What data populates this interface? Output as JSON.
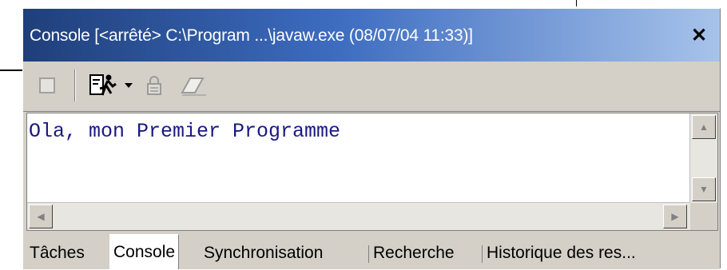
{
  "window": {
    "title": "Console [<arrêté> C:\\Program ...\\javaw.exe (08/07/04 11:33)]",
    "close_symbol": "✕"
  },
  "toolbar": {
    "icons": [
      "terminate-icon",
      "run-debug-icon",
      "dropdown-arrow-icon",
      "pin-icon",
      "clear-console-icon"
    ]
  },
  "console": {
    "output": "Ola, mon Premier Programme"
  },
  "tabs": [
    {
      "label": "Tâches",
      "active": false
    },
    {
      "label": "Console",
      "active": true
    },
    {
      "label": "Synchronisation",
      "active": false
    },
    {
      "label": "Recherche",
      "active": false
    },
    {
      "label": "Historique des res...",
      "active": false
    }
  ],
  "colors": {
    "title_gradient_start": "#1f3f7a",
    "title_gradient_end": "#a7c3ea",
    "console_text": "#1a1a80",
    "chrome": "#d4d0c8"
  }
}
